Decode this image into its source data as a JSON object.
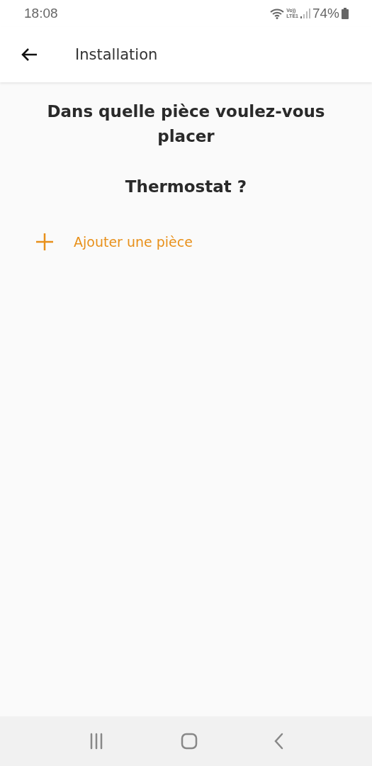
{
  "status_bar": {
    "time": "18:08",
    "voice": "Vo))",
    "network": "LTE1",
    "battery": "74%"
  },
  "app_bar": {
    "title": "Installation"
  },
  "question": {
    "line": "Dans quelle pièce voulez-vous placer",
    "device": "Thermostat ?"
  },
  "add_room": {
    "label": "Ajouter une pièce"
  }
}
